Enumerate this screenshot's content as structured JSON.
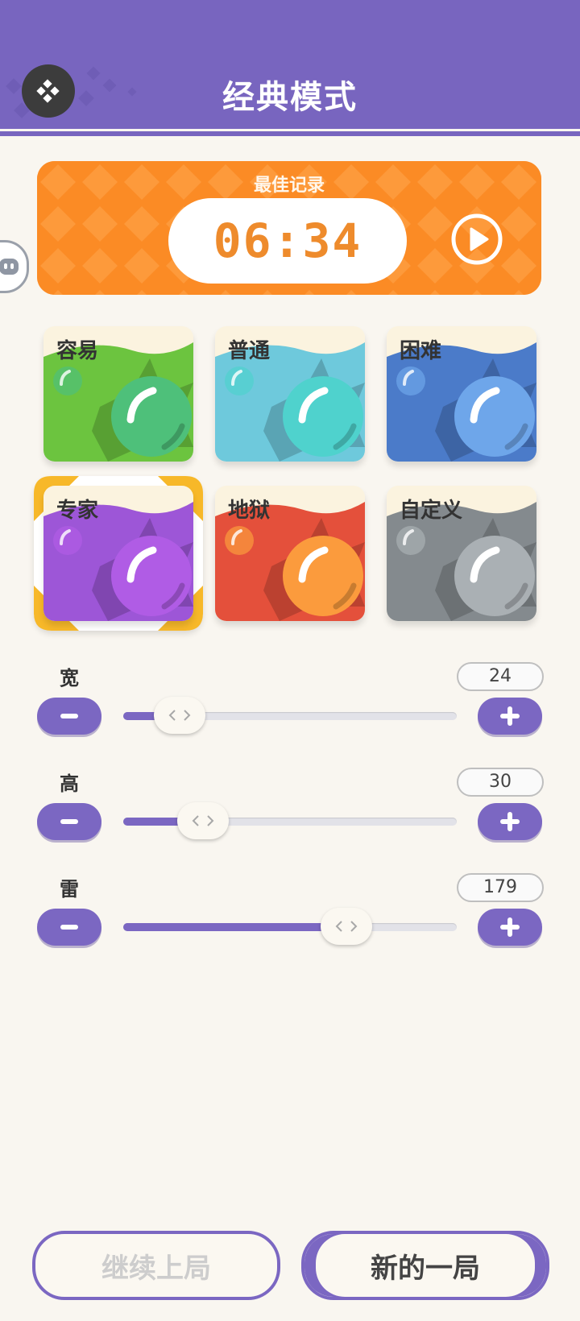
{
  "header": {
    "title": "经典模式",
    "back_icon": "back-arrow-icon",
    "color": "#7865bf"
  },
  "record": {
    "label": "最佳记录",
    "time": "06:34",
    "color": "#fb8b25",
    "play_icon": "play-icon"
  },
  "difficulties": [
    {
      "label": "容易",
      "bg": "#6cc43f",
      "ball": "#4ec07a",
      "selected": false
    },
    {
      "label": "普通",
      "bg": "#6ec9dc",
      "ball": "#4fd2cd",
      "selected": false
    },
    {
      "label": "困难",
      "bg": "#4b7bc9",
      "ball": "#6ea6ea",
      "selected": false
    },
    {
      "label": "专家",
      "bg": "#9d56d7",
      "ball": "#b05ce5",
      "selected": true
    },
    {
      "label": "地狱",
      "bg": "#e4503b",
      "ball": "#fb9b3d",
      "selected": false
    },
    {
      "label": "自定义",
      "bg": "#848a8e",
      "ball": "#aab0b4",
      "selected": false
    }
  ],
  "sliders": [
    {
      "label": "宽",
      "value": "24",
      "fraction": 0.17
    },
    {
      "label": "高",
      "value": "30",
      "fraction": 0.24
    },
    {
      "label": "雷",
      "value": "179",
      "fraction": 0.67
    }
  ],
  "buttons": {
    "continue": "继续上局",
    "new_game": "新的一局"
  },
  "accent": "#7b67c2"
}
